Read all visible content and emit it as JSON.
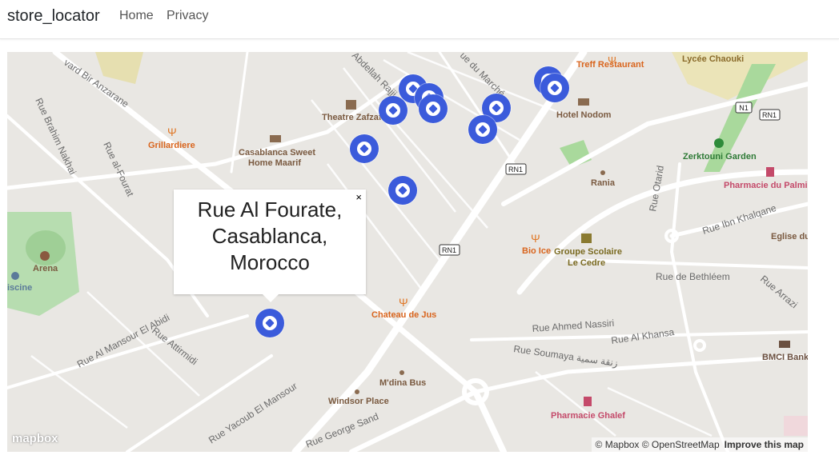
{
  "navbar": {
    "brand": "store_locator",
    "links": [
      "Home",
      "Privacy"
    ]
  },
  "map": {
    "popup_text": "Rue Al Fourate, Casablanca, Morocco",
    "popup_close": "×",
    "logo": "mapbox",
    "attribution": "© Mapbox © OpenStreetMap",
    "improve": "Improve this map",
    "marker_color": "#3b5bdb",
    "places": {
      "treff": "Treff Restaurant",
      "lycee": "Lycée Chaouki",
      "hotel": "Hotel Nodom",
      "theatre": "Theatre Zafzaf",
      "grill": "Grillardiere",
      "casablanca_sweet_1": "Casablanca Sweet",
      "casablanca_sweet_2": "Home Maarif",
      "zerktouni": "Zerktouni Garden",
      "rania": "Rania",
      "pharm_palmier": "Pharmacie du Palmi",
      "bio": "Bio Ice",
      "groupe1": "Groupe Scolaire",
      "groupe2": "Le Cedre",
      "arena": "Arena",
      "piscine": "iscine",
      "eglise": "Eglise du",
      "chateau": "Chateau de Jus",
      "mdina": "M'dina Bus",
      "windsor": "Windsor Place",
      "pharm_ghalef": "Pharmacie Ghalef",
      "bmci": "BMCI Bank"
    },
    "streets": {
      "bir_anzarane": "vard Bir Anzarane",
      "brahim": "Rue Brahim Nakhai",
      "al_fourat": "Rue al-Fourat",
      "abdellah": "Abdellah Rajji",
      "marche": "ue du Marché",
      "ibn_khalqane": "Rue Ibn Khalqane",
      "bethleem": "Rue de Bethléem",
      "arrazi": "Rue Arrazi",
      "ahmed": "Rue Ahmed Nassiri",
      "khansa": "Rue Al Khansa",
      "soumaya": "Rue Soumaya زنقة سمية",
      "mansour_abidi": "Rue Al Mansour El Abidi",
      "attirmidi": "Rue Attirmidi",
      "yacoub": "Rue Yacoub El Mansour",
      "george": "Rue George Sand",
      "otarid": "Rue Otarid",
      "rn1": "RN1",
      "n1": "N1"
    }
  }
}
